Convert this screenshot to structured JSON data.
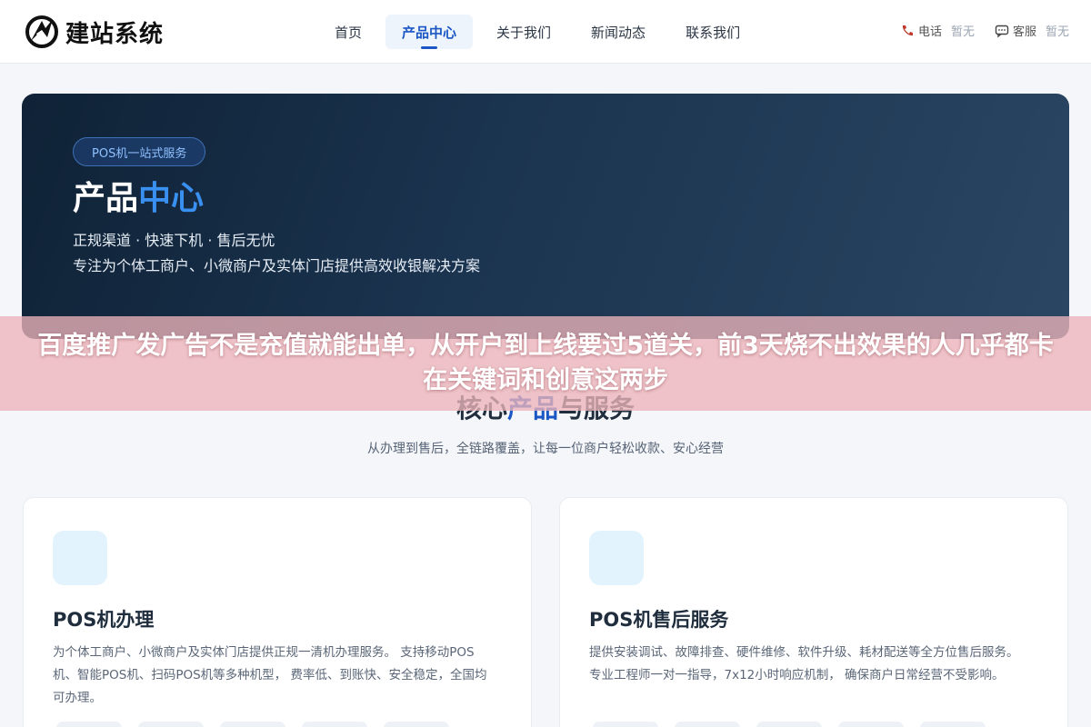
{
  "site": {
    "name": "建站系统"
  },
  "nav": {
    "items": [
      {
        "label": "首页",
        "active": false
      },
      {
        "label": "产品中心",
        "active": true
      },
      {
        "label": "关于我们",
        "active": false
      },
      {
        "label": "新闻动态",
        "active": false
      },
      {
        "label": "联系我们",
        "active": false
      }
    ]
  },
  "contact": {
    "phone_label": "电话",
    "phone_value": "暂无",
    "service_label": "客服",
    "service_value": "暂无"
  },
  "hero": {
    "badge": "POS机一站式服务",
    "title_main": "产品",
    "title_accent": "中心",
    "line1": "正规渠道 · 快速下机 · 售后无忧",
    "line2": "专注为个体工商户、小微商户及实体门店提供高效收银解决方案"
  },
  "overlay": {
    "text": "百度推广发广告不是充值就能出单，从开户到上线要过5道关，前3天烧不出效果的人几乎都卡在关键词和创意这两步"
  },
  "section": {
    "title_main": "核心",
    "title_accent": "产品",
    "title_tail": "与服务",
    "subtitle": "从办理到售后，全链路覆盖，让每一位商户轻松收款、安心经营"
  },
  "cards": [
    {
      "title": "POS机办理",
      "desc": "为个体工商户、小微商户及实体门店提供正规一清机办理服务。 支持移动POS机、智能POS机、扫码POS机等多种机型， 费率低、到账快、安全稳定，全国均可办理。"
    },
    {
      "title": "POS机售后服务",
      "desc": "提供安装调试、故障排查、硬件维修、软件升级、耗材配送等全方位售后服务。 专业工程师一对一指导，7x12小时响应机制， 确保商户日常经营不受影响。"
    }
  ],
  "colors": {
    "brand": "#1a56c4",
    "hero_bg": "#1b3450",
    "overlay": "#ecb4ba"
  }
}
